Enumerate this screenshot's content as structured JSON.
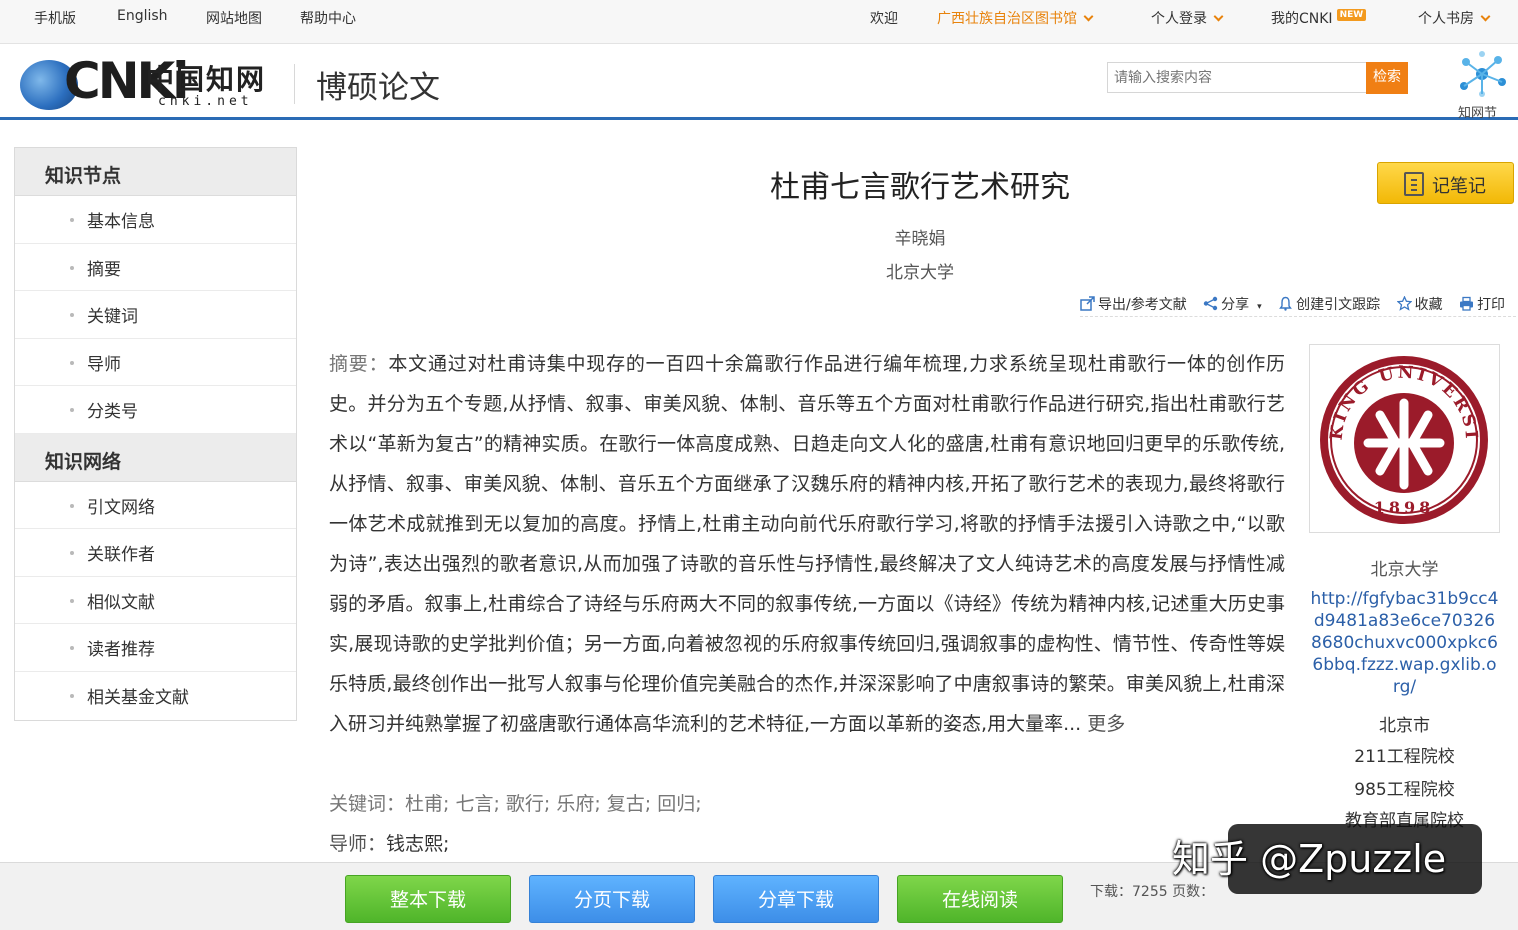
{
  "topbar": {
    "mobile": "手机版",
    "english": "English",
    "sitemap": "网站地图",
    "help": "帮助中心",
    "welcome": "欢迎",
    "institution": "广西壮族自治区图书馆",
    "login": "个人登录",
    "mycnki": "我的CNKI",
    "new_badge": "NEW",
    "bookroom": "个人书房"
  },
  "header": {
    "logo_text": "CNKi",
    "logo_cn": "中国知网",
    "logo_net": "cnki.net",
    "section_title": "博硕论文",
    "search_placeholder": "请输入搜索内容",
    "search_button": "检索",
    "zhiwangjie": "知网节"
  },
  "sidebar": {
    "nodes_title": "知识节点",
    "nodes": [
      "基本信息",
      "摘要",
      "关键词",
      "导师",
      "分类号"
    ],
    "network_title": "知识网络",
    "network": [
      "引文网络",
      "关联作者",
      "相似文献",
      "读者推荐",
      "相关基金文献"
    ]
  },
  "paper": {
    "title": "杜甫七言歌行艺术研究",
    "author": "辛晓娟",
    "organization": "北京大学",
    "note_button": "记笔记",
    "abstract_label": "摘要：",
    "abstract_text": "本文通过对杜甫诗集中现存的一百四十余篇歌行作品进行编年梳理,力求系统呈现杜甫歌行一体的创作历史。并分为五个专题,从抒情、叙事、审美风貌、体制、音乐等五个方面对杜甫歌行作品进行研究,指出杜甫歌行艺术以“革新为复古”的精神实质。在歌行一体高度成熟、日趋走向文人化的盛唐,杜甫有意识地回归更早的乐歌传统,从抒情、叙事、审美风貌、体制、音乐五个方面继承了汉魏乐府的精神内核,开拓了歌行艺术的表现力,最终将歌行一体艺术成就推到无以复加的高度。抒情上,杜甫主动向前代乐府歌行学习,将歌的抒情手法援引入诗歌之中,“以歌为诗”,表达出强烈的歌者意识,从而加强了诗歌的音乐性与抒情性,最终解决了文人纯诗艺术的高度发展与抒情性减弱的矛盾。叙事上,杜甫综合了诗经与乐府两大不同的叙事传统,一方面以《诗经》传统为精神内核,记述重大历史事实,展现诗歌的史学批判价值；另一方面,向着被忽视的乐府叙事传统回归,强调叙事的虚构性、情节性、传奇性等娱乐特质,最终创作出一批写人叙事与伦理价值完美融合的杰作,并深深影响了中唐叙事诗的繁荣。审美风貌上,杜甫深入研习并纯熟掌握了初盛唐歌行通体高华流利的艺术特征,一方面以革新的姿态,用大量率...",
    "abstract_more": "更多",
    "keywords_label": "关键词：",
    "keywords": "杜甫; 七言; 歌行; 乐府; 复古; 回归;",
    "tutor_label": "导师：",
    "tutor": "钱志熙;"
  },
  "tools": {
    "export": "导出/参考文献",
    "share": "分享",
    "track": "创建引文跟踪",
    "favorite": "收藏",
    "print": "打印"
  },
  "university": {
    "logo_top": "PEKING UNIVERSITY",
    "logo_year": "1898",
    "name": "北京大学",
    "url": "http://fgfybac31b9cc4d9481a83e6ce703268680chuxvc000xpkc66bbq.fzzz.wap.gxlib.org/",
    "city": "北京市",
    "tag1": "211工程院校",
    "tag2": "985工程院校",
    "tag3": "教育部直属院校"
  },
  "download": {
    "whole": "整本下载",
    "page": "分页下载",
    "chapter": "分章下载",
    "online": "在线阅读",
    "info": "下载：7255  页数："
  },
  "watermark": "知乎 @Zpuzzle",
  "colors": {
    "accent_blue": "#2a6bb5",
    "orange": "#f07f14",
    "green_button": "#4fb52a",
    "blue_button": "#3d8ee8",
    "link": "#2b5fa8"
  }
}
